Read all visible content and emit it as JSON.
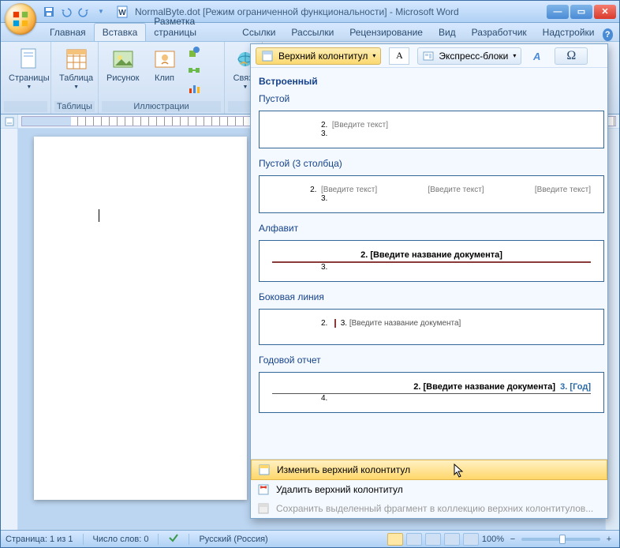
{
  "title": "NormalByte.dot [Режим ограниченной функциональности] - Microsoft Word",
  "tabs": [
    "Главная",
    "Вставка",
    "Разметка страницы",
    "Ссылки",
    "Рассылки",
    "Рецензирование",
    "Вид",
    "Разработчик",
    "Надстройки"
  ],
  "active_tab_index": 1,
  "ribbon": {
    "pages": "Страницы",
    "table": "Таблица",
    "tables_group": "Таблицы",
    "picture": "Рисунок",
    "clip": "Клип",
    "illustrations_group": "Иллюстрации",
    "links": "Связи",
    "header_dd": "Верхний колонтитул",
    "textbox_A": "A",
    "quickparts": "Экспресс-блоки",
    "symbol": "Ω"
  },
  "gallery": {
    "category": "Встроенный",
    "items": [
      {
        "title": "Пустой",
        "ph": "[Введите текст]"
      },
      {
        "title": "Пустой (3 столбца)",
        "ph": "[Введите текст]"
      },
      {
        "title": "Алфавит",
        "ph": "[Введите название документа]"
      },
      {
        "title": "Боковая линия",
        "ph": "[Введите название документа]"
      },
      {
        "title": "Годовой отчет",
        "ph": "[Введите название документа]",
        "year": "[Год]"
      }
    ],
    "footer": {
      "edit": "Изменить верхний колонтитул",
      "remove": "Удалить верхний колонтитул",
      "save": "Сохранить выделенный фрагмент в коллекцию верхних колонтитулов..."
    }
  },
  "status": {
    "page": "Страница: 1 из 1",
    "words": "Число слов: 0",
    "lang": "Русский (Россия)",
    "zoom": "100%"
  },
  "nums": {
    "n2": "2.",
    "n3": "3.",
    "n4": "4."
  }
}
